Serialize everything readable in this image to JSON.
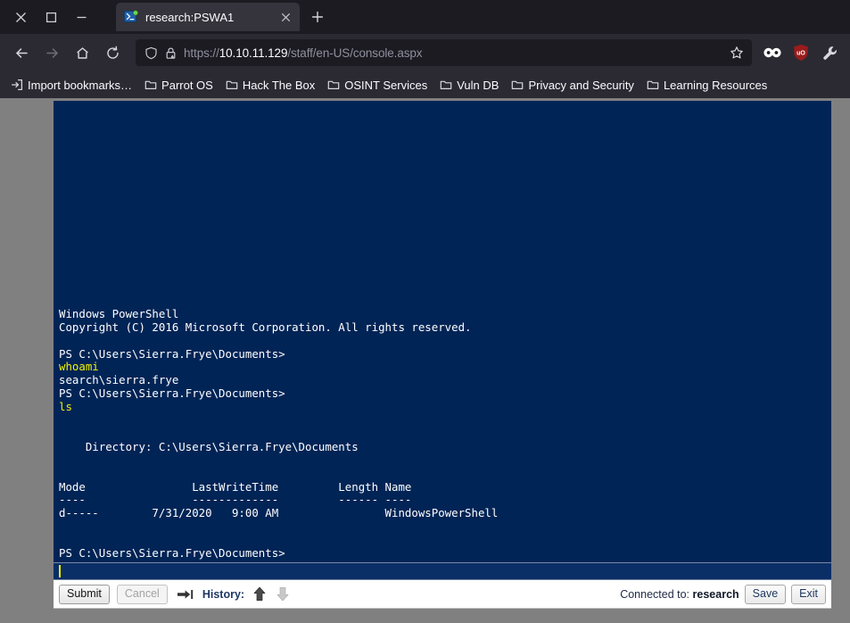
{
  "window": {
    "controls": [
      {
        "name": "close",
        "glyph": "close-icon"
      },
      {
        "name": "maximize",
        "glyph": "maximize-icon"
      },
      {
        "name": "minimize",
        "glyph": "minimize-icon"
      }
    ]
  },
  "tabs": [
    {
      "title": "research:PSWA1",
      "favicon": "powershell-icon",
      "active": true
    }
  ],
  "newtab": {
    "label": "+",
    "tooltip": "New tab"
  },
  "nav": {
    "back": "back-arrow-icon",
    "forward": "forward-arrow-icon",
    "home": "home-icon",
    "reload": "reload-icon"
  },
  "urlbar": {
    "shield": "shield-icon",
    "lock": "lock-warning-icon",
    "scheme": "https://",
    "host": "10.10.11.129",
    "path": "/staff/en-US/console.aspx",
    "full_url": "https://10.10.11.129/staff/en-US/console.aspx",
    "bookmark_star": "star-icon"
  },
  "extensions": [
    {
      "name": "foxyproxy-icon",
      "label": "FoxyProxy",
      "color": "#ffffff"
    },
    {
      "name": "ublock-origin-icon",
      "label": "uO",
      "color": "#9b1c1c"
    },
    {
      "name": "wrench-icon",
      "label": "Developer tools",
      "color": "#d8d8e0"
    }
  ],
  "bookmarks": [
    {
      "label": "Import bookmarks…",
      "icon": "import-icon"
    },
    {
      "label": "Parrot OS",
      "icon": "folder-icon"
    },
    {
      "label": "Hack The Box",
      "icon": "folder-icon"
    },
    {
      "label": "OSINT Services",
      "icon": "folder-icon"
    },
    {
      "label": "Vuln DB",
      "icon": "folder-icon"
    },
    {
      "label": "Privacy and Security",
      "icon": "folder-icon"
    },
    {
      "label": "Learning Resources",
      "icon": "folder-icon"
    }
  ],
  "console": {
    "background": "#012456",
    "foreground": "#ffffff",
    "command_color": "#f2f200",
    "banner": [
      "Windows PowerShell",
      "Copyright (C) 2016 Microsoft Corporation. All rights reserved."
    ],
    "lines": [
      {
        "text": "Windows PowerShell",
        "kind": "output"
      },
      {
        "text": "Copyright (C) 2016 Microsoft Corporation. All rights reserved.",
        "kind": "output"
      },
      {
        "text": "",
        "kind": "blank"
      },
      {
        "text": "PS C:\\Users\\Sierra.Frye\\Documents>",
        "kind": "prompt"
      },
      {
        "text": "whoami",
        "kind": "command"
      },
      {
        "text": "search\\sierra.frye",
        "kind": "output"
      },
      {
        "text": "PS C:\\Users\\Sierra.Frye\\Documents>",
        "kind": "prompt"
      },
      {
        "text": "ls",
        "kind": "command"
      },
      {
        "text": "",
        "kind": "blank"
      },
      {
        "text": "",
        "kind": "blank"
      },
      {
        "text": "    Directory: C:\\Users\\Sierra.Frye\\Documents",
        "kind": "output"
      },
      {
        "text": "",
        "kind": "blank"
      },
      {
        "text": "",
        "kind": "blank"
      },
      {
        "text": "Mode                LastWriteTime         Length Name",
        "kind": "output"
      },
      {
        "text": "----                -------------         ------ ----",
        "kind": "output"
      },
      {
        "text": "d-----        7/31/2020   9:00 AM                WindowsPowerShell",
        "kind": "output"
      },
      {
        "text": "",
        "kind": "blank"
      },
      {
        "text": "",
        "kind": "blank"
      },
      {
        "text": "PS C:\\Users\\Sierra.Frye\\Documents>",
        "kind": "prompt"
      }
    ],
    "directory_listing": {
      "header": "    Directory: C:\\Users\\Sierra.Frye\\Documents",
      "columns": [
        "Mode",
        "LastWriteTime",
        "Length",
        "Name"
      ],
      "rule": "----                -------------         ------ ----",
      "rows": [
        {
          "mode": "d-----",
          "last_write_date": "7/31/2020",
          "last_write_time": "9:00 AM",
          "length": "",
          "name": "WindowsPowerShell"
        }
      ]
    },
    "current_prompt": "PS C:\\Users\\Sierra.Frye\\Documents>",
    "input_value": "",
    "input_placeholder": ""
  },
  "toolbar": {
    "submit_label": "Submit",
    "submit_enabled": true,
    "cancel_label": "Cancel",
    "cancel_enabled": false,
    "tabkey_icon": "tab-key-icon",
    "history_label": "History:",
    "history_up_icon": "arrow-up-icon",
    "history_up_enabled": true,
    "history_down_icon": "arrow-down-icon",
    "history_down_enabled": false,
    "connected_prefix": "Connected to:",
    "connected_target": "research",
    "save_label": "Save",
    "exit_label": "Exit"
  }
}
